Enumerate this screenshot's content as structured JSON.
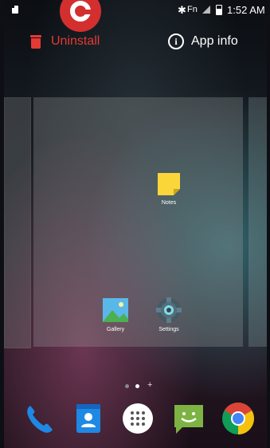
{
  "status_bar": {
    "time": "1:52 AM",
    "fn_label": "Fn"
  },
  "drop_targets": {
    "uninstall_label": "Uninstall",
    "app_info_label": "App info"
  },
  "workspace": {
    "apps": [
      {
        "label": "Notes",
        "icon": "notes-icon"
      },
      {
        "label": "Gallery",
        "icon": "gallery-icon"
      },
      {
        "label": "Settings",
        "icon": "settings-icon"
      }
    ],
    "page_indicator": {
      "pages": 2,
      "current_page": 2,
      "add_symbol": "+"
    }
  },
  "dock": {
    "items": [
      "phone-icon",
      "contacts-icon",
      "app-drawer-icon",
      "messaging-icon",
      "chrome-icon"
    ]
  },
  "colors": {
    "uninstall": "#e53935",
    "notes": "#fbd63a",
    "chrome_red": "#db4437",
    "chrome_yellow": "#f4c20d",
    "chrome_green": "#0f9d58",
    "chrome_blue": "#4285f4"
  }
}
